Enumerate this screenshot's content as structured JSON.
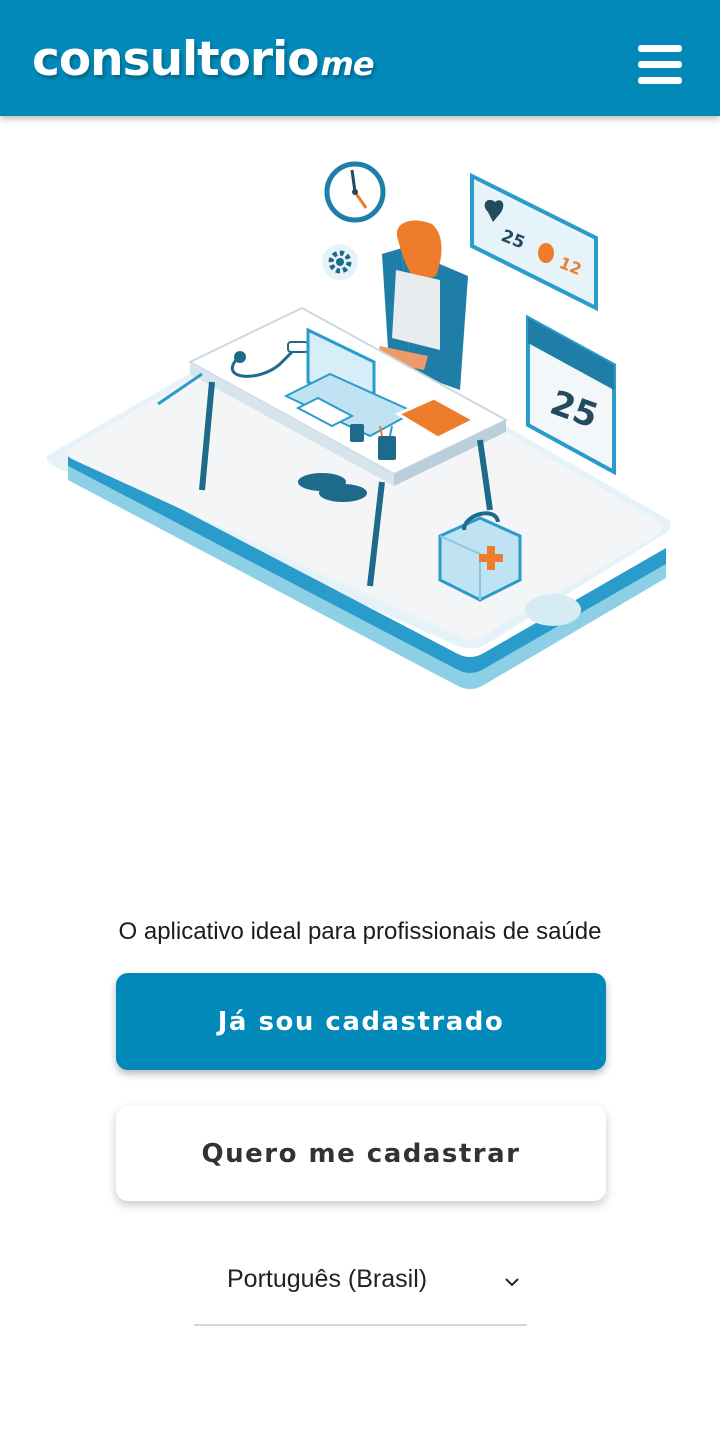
{
  "header": {
    "logo_main": "consultorio",
    "logo_suffix": "me",
    "menu_icon": "hamburger-menu-icon"
  },
  "illustration": {
    "likes": "25",
    "comments": "12",
    "calendar_day": "25"
  },
  "tagline": "O aplicativo ideal para profissionais de saúde",
  "buttons": {
    "login": "Já sou cadastrado",
    "signup": "Quero me cadastrar"
  },
  "language": {
    "selected": "Português (Brasil)",
    "icon": "chevron-down-icon"
  },
  "colors": {
    "brand": "#0089b9",
    "accent": "#ee7d2b"
  }
}
